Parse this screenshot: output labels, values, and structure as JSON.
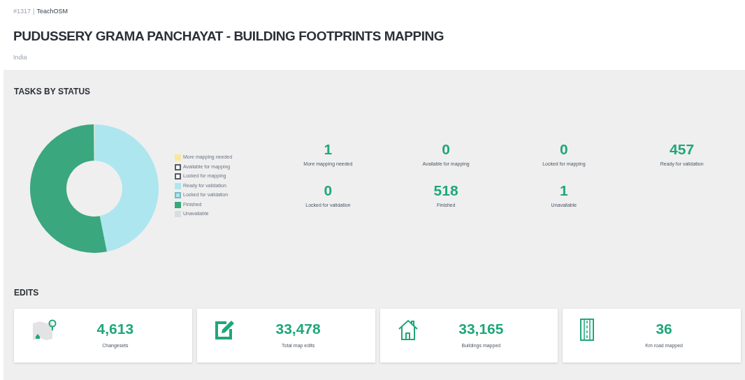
{
  "header": {
    "project_id": "#1317",
    "separator": "|",
    "organisation": "TeachOSM",
    "title": "PUDUSSERY GRAMA PANCHAYAT - BUILDING FOOTPRINTS MAPPING",
    "country": "India"
  },
  "tasks_by_status": {
    "heading": "TASKS BY STATUS",
    "legend": [
      {
        "label": "More mapping needed",
        "color": "#f9e79a",
        "kind": "fill"
      },
      {
        "label": "Available for mapping",
        "color": "#ffffff",
        "kind": "outline"
      },
      {
        "label": "Locked for mapping",
        "color": "#ffffff",
        "kind": "outline"
      },
      {
        "label": "Ready for validation",
        "color": "#ade6ef",
        "kind": "fill"
      },
      {
        "label": "Locked for validation",
        "color": "#ade6ef",
        "kind": "outline"
      },
      {
        "label": "Finished",
        "color": "#3aa77f",
        "kind": "fill"
      },
      {
        "label": "Unavailable",
        "color": "#d9dde0",
        "kind": "fill"
      }
    ],
    "stats": [
      {
        "value": "1",
        "label": "More mapping needed"
      },
      {
        "value": "0",
        "label": "Available for mapping"
      },
      {
        "value": "0",
        "label": "Locked for mapping"
      },
      {
        "value": "457",
        "label": "Ready for validation"
      },
      {
        "value": "0",
        "label": "Locked for validation"
      },
      {
        "value": "518",
        "label": "Finished"
      },
      {
        "value": "1",
        "label": "Unavailable"
      }
    ]
  },
  "edits": {
    "heading": "EDITS",
    "cards": [
      {
        "kind": "map",
        "value": "4,613",
        "label": "Changesets"
      },
      {
        "kind": "edit",
        "value": "33,478",
        "label": "Total map edits"
      },
      {
        "kind": "house",
        "value": "33,165",
        "label": "Buildings mapped"
      },
      {
        "kind": "road",
        "value": "36",
        "label": "Km road mapped"
      }
    ]
  }
}
